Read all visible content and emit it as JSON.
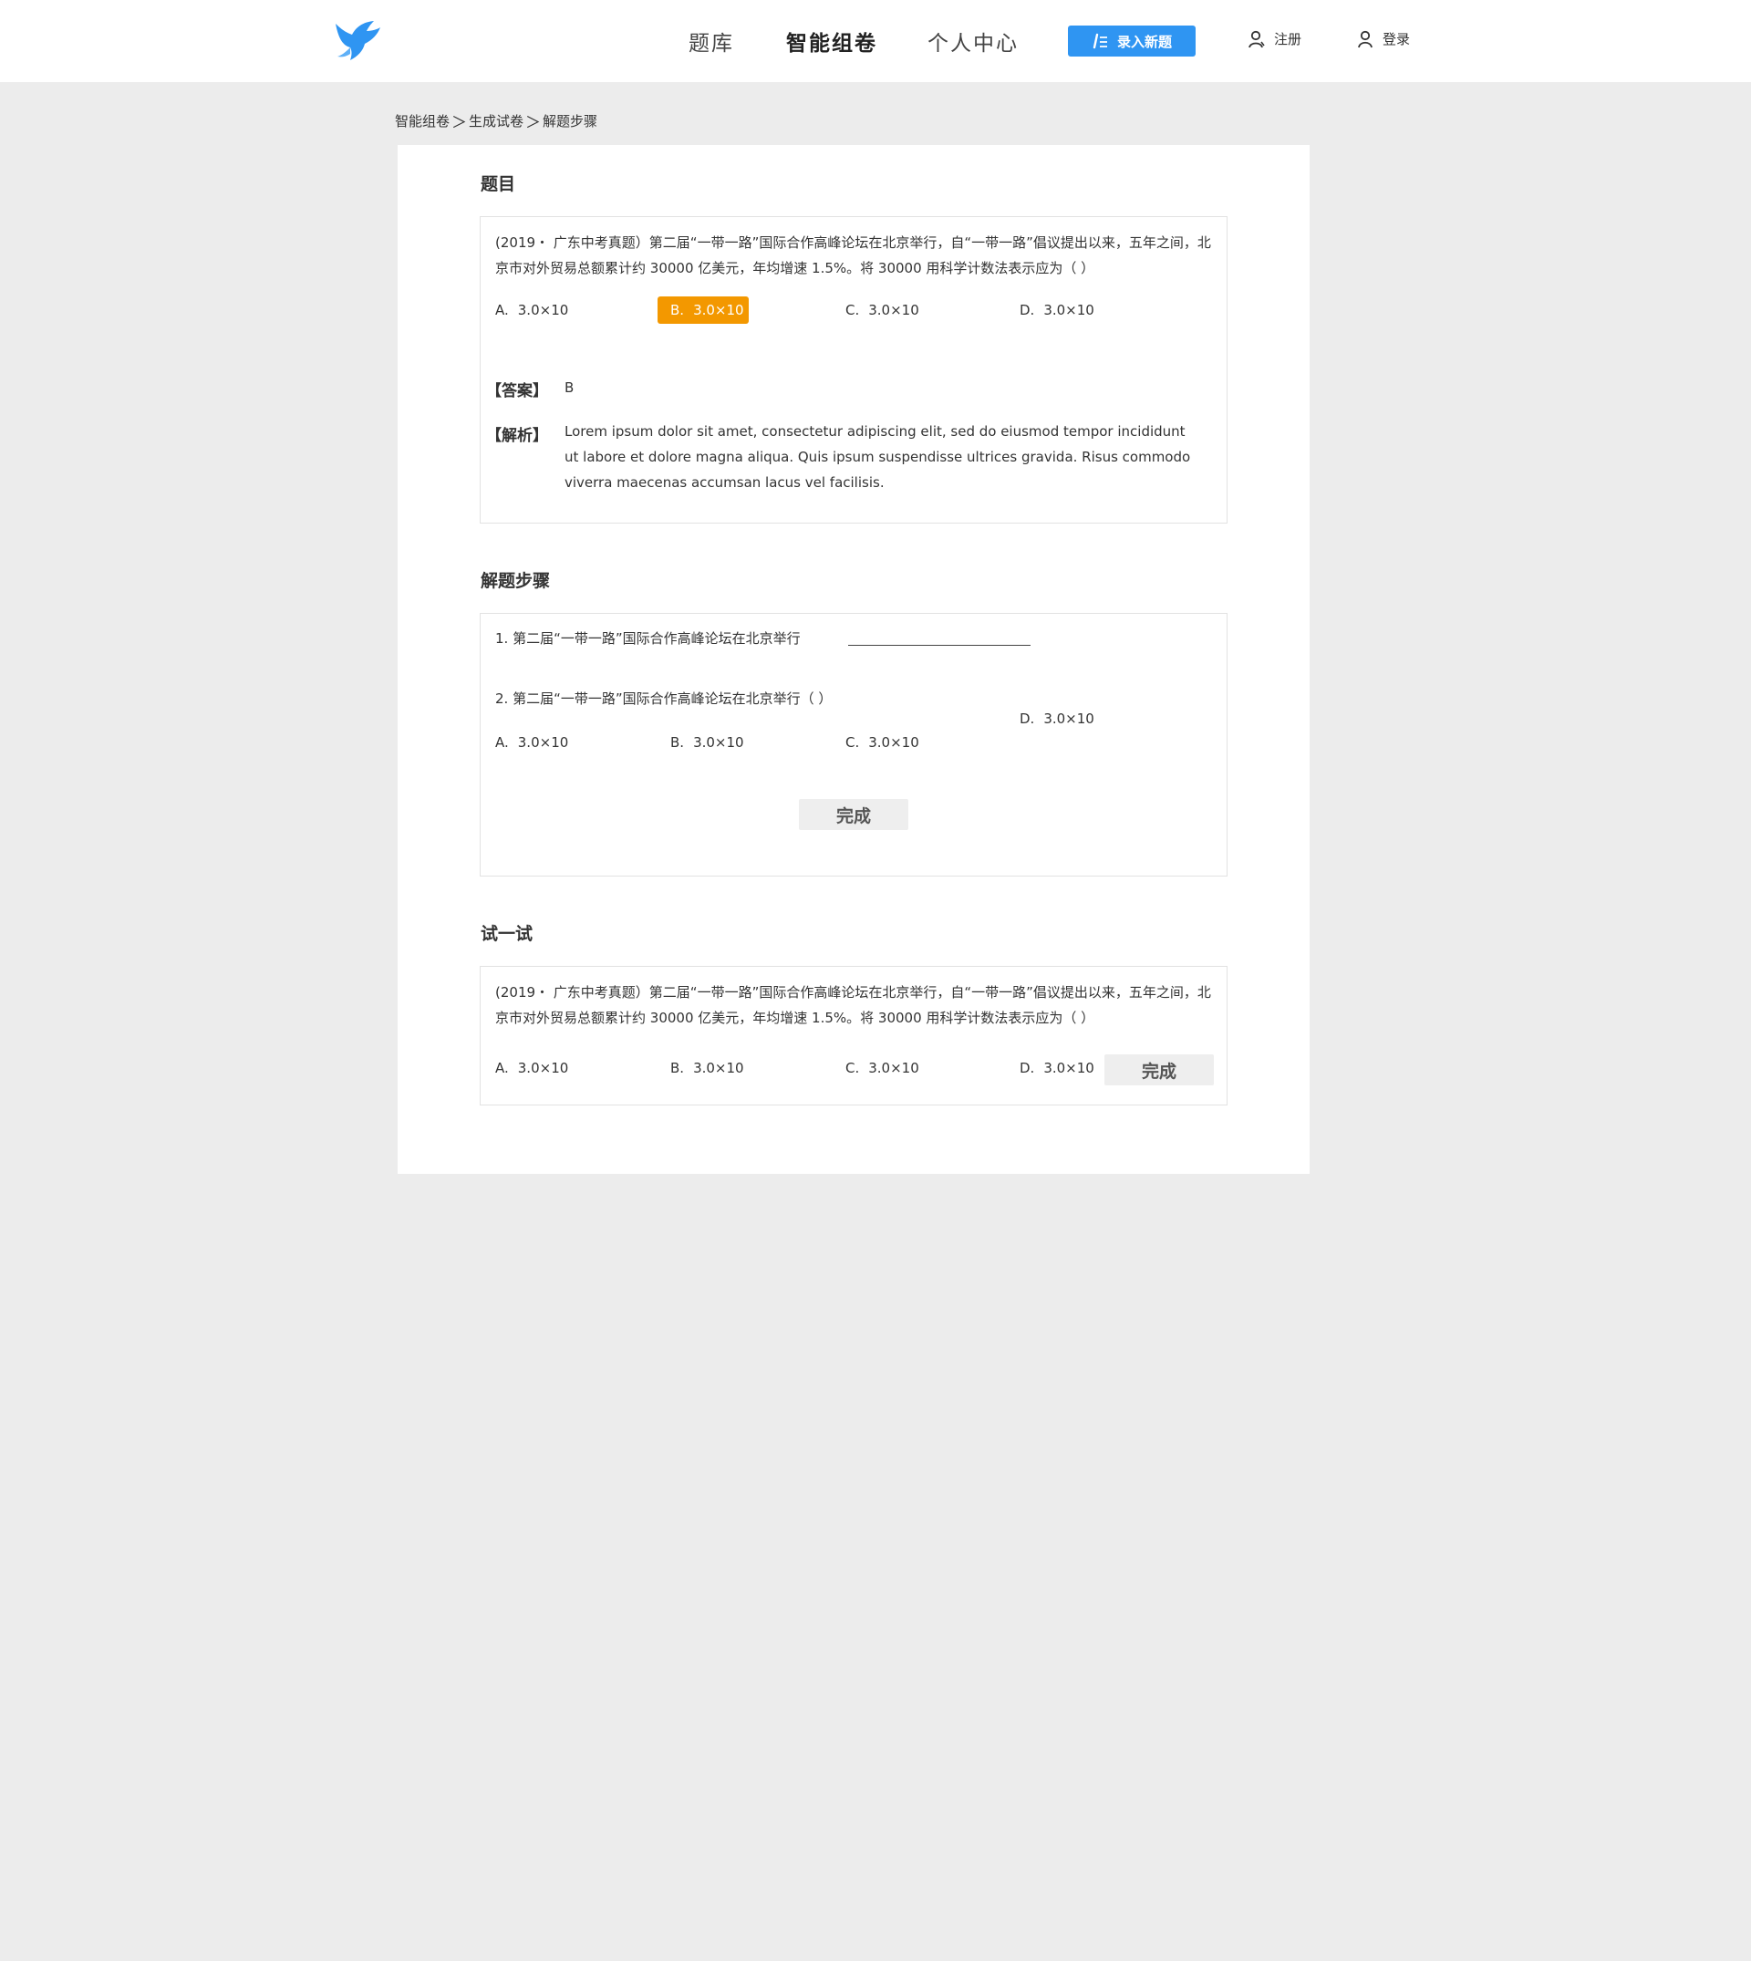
{
  "header": {
    "logo": "bird-logo",
    "nav": [
      {
        "label": "题库"
      },
      {
        "label": "智能组卷"
      },
      {
        "label": "个人中心"
      }
    ],
    "add_button": "录入新题",
    "register": "注册",
    "login": "登录",
    "accent_color": "#2f95f2"
  },
  "breadcrumb": {
    "items": [
      "智能组卷",
      "生成试卷",
      "解题步骤"
    ],
    "separator": "＞"
  },
  "question_section": {
    "title": "题目",
    "text": "(2019・ 广东中考真题）第二届“一带一路”国际合作高峰论坛在北京举行，自“一带一路”倡议提出以来，五年之间，北京市对外贸易总额累计约 30000 亿美元，年均增速 1.5%。将 30000 用科学计数法表示应为（    ）",
    "options": [
      {
        "letter": "A.",
        "value": "3.0×10",
        "selected": false
      },
      {
        "letter": "B.",
        "value": "3.0×10",
        "selected": true
      },
      {
        "letter": "C.",
        "value": "3.0×10",
        "selected": false
      },
      {
        "letter": "D.",
        "value": "3.0×10",
        "selected": false
      }
    ],
    "selected_color": "#f39800",
    "answer_label": "【答案】",
    "answer": "B",
    "analysis_label": "【解析】",
    "analysis": "Lorem ipsum dolor sit amet, consectetur adipiscing elit, sed do eiusmod tempor incididunt ut labore et dolore magna aliqua. Quis ipsum suspendisse ultrices gravida. Risus commodo viverra maecenas accumsan lacus vel facilisis."
  },
  "steps_section": {
    "title": "解题步骤",
    "step1": "1. 第二届“一带一路”国际合作高峰论坛在北京举行",
    "step2": "2. 第二届“一带一路”国际合作高峰论坛在北京举行（    ）",
    "options": [
      {
        "letter": "A.",
        "value": "3.0×10"
      },
      {
        "letter": "B.",
        "value": "3.0×10"
      },
      {
        "letter": "C.",
        "value": "3.0×10"
      },
      {
        "letter": "D.",
        "value": "3.0×10"
      }
    ],
    "done_button": "完成"
  },
  "try_section": {
    "title": "试一试",
    "text": "(2019・ 广东中考真题）第二届“一带一路”国际合作高峰论坛在北京举行，自“一带一路”倡议提出以来，五年之间，北京市对外贸易总额累计约 30000 亿美元，年均增速 1.5%。将 30000 用科学计数法表示应为（    ）",
    "options": [
      {
        "letter": "A.",
        "value": "3.0×10"
      },
      {
        "letter": "B.",
        "value": "3.0×10"
      },
      {
        "letter": "C.",
        "value": "3.0×10"
      },
      {
        "letter": "D.",
        "value": "3.0×10"
      }
    ],
    "done_button": "完成"
  }
}
